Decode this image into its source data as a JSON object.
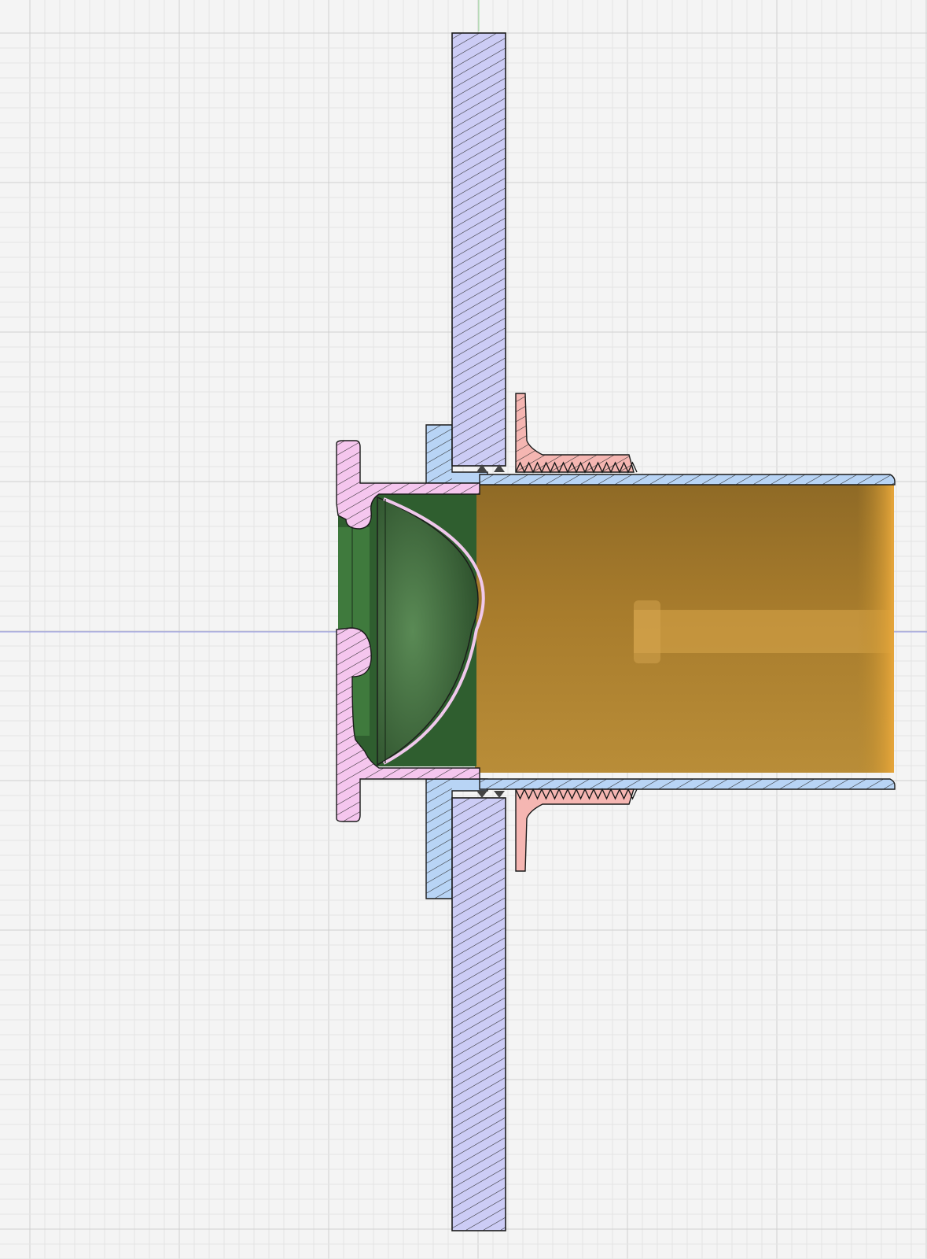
{
  "viewport": {
    "view_mode": "section-analysis",
    "background_color": "#f4f4f4",
    "grid": {
      "visible": true,
      "minor_color": "#e4e4e4",
      "major_color": "#cfcfcf"
    },
    "axes": {
      "horizontal_color": "#8f93e6",
      "vertical_color": "#9fe09f"
    }
  },
  "components": [
    {
      "id": "wall-panel",
      "color": "#ccccf5",
      "hatched": true
    },
    {
      "id": "outer-flange-bezel",
      "color": "#f5c6ee",
      "hatched": true
    },
    {
      "id": "threaded-sleeve",
      "color": "#b8d4f5",
      "hatched": true
    },
    {
      "id": "lock-nut",
      "color": "#f5b6b2",
      "hatched": true
    },
    {
      "id": "dome-lens",
      "color": "#2f5e2f",
      "hatched": false
    },
    {
      "id": "tube-body",
      "color": "#b98a2c",
      "hatched": false
    }
  ]
}
